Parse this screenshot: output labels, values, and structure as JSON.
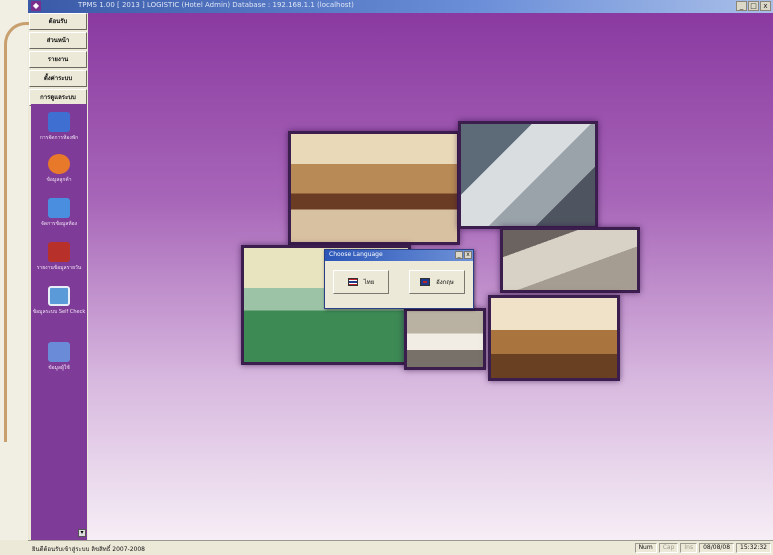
{
  "window": {
    "title": "TPMS  1.00 [ 2013 ]  LOGISTIC (Hotel Admin)  Database : 192.168.1.1 (localhost)",
    "icon": "app-icon",
    "controls": [
      "_",
      "□",
      "x"
    ]
  },
  "menu": {
    "items": [
      {
        "label": "ต้อนรับ"
      },
      {
        "label": "ส่วนหน้า"
      },
      {
        "label": "รายงาน"
      },
      {
        "label": "ตั้งค่าระบบ"
      },
      {
        "label": "การดูแลระบบ"
      }
    ]
  },
  "sidebar": {
    "items": [
      {
        "label": "การจัดการห้องพัก",
        "icon": "monitor-icon",
        "color": "#3f6fd0"
      },
      {
        "label": "ข้อมูลลูกค้า",
        "icon": "guest-icon",
        "color": "#e8782a"
      },
      {
        "label": "จัดการข้อมูลห้อง",
        "icon": "room-cube-icon",
        "color": "#4a8ee0"
      },
      {
        "label": "รายงานข้อมูลรายวัน",
        "icon": "report-icon",
        "color": "#b8302a"
      },
      {
        "label": "ข้อมูลระบบ Self Check",
        "icon": "calendar-icon",
        "color": "#5a9ad8"
      },
      {
        "label": "ข้อมูลผู้ใช้",
        "icon": "user-icon",
        "color": "#6a8cd8"
      }
    ]
  },
  "dialog": {
    "title": "Choose Language",
    "controls": [
      "_",
      "x"
    ],
    "buttons": [
      {
        "label": "ไทย",
        "flag": "thai-flag-icon"
      },
      {
        "label": "อังกฤษ",
        "flag": "english-flag-icon"
      }
    ]
  },
  "status": {
    "message": "ยินดีต้อนรับเข้าสู่ระบบ ลิขสิทธิ์ 2007-2008",
    "cells": [
      {
        "label": "Num",
        "dim": false
      },
      {
        "label": "Cap",
        "dim": true
      },
      {
        "label": "Ins",
        "dim": true
      },
      {
        "label": "08/08/08",
        "dim": false
      },
      {
        "label": "15:32:32",
        "dim": false
      }
    ]
  },
  "colors": {
    "accent": "#7f3b98",
    "titlebar": "#3a5aa8",
    "dialog_title": "#2a56b8"
  }
}
